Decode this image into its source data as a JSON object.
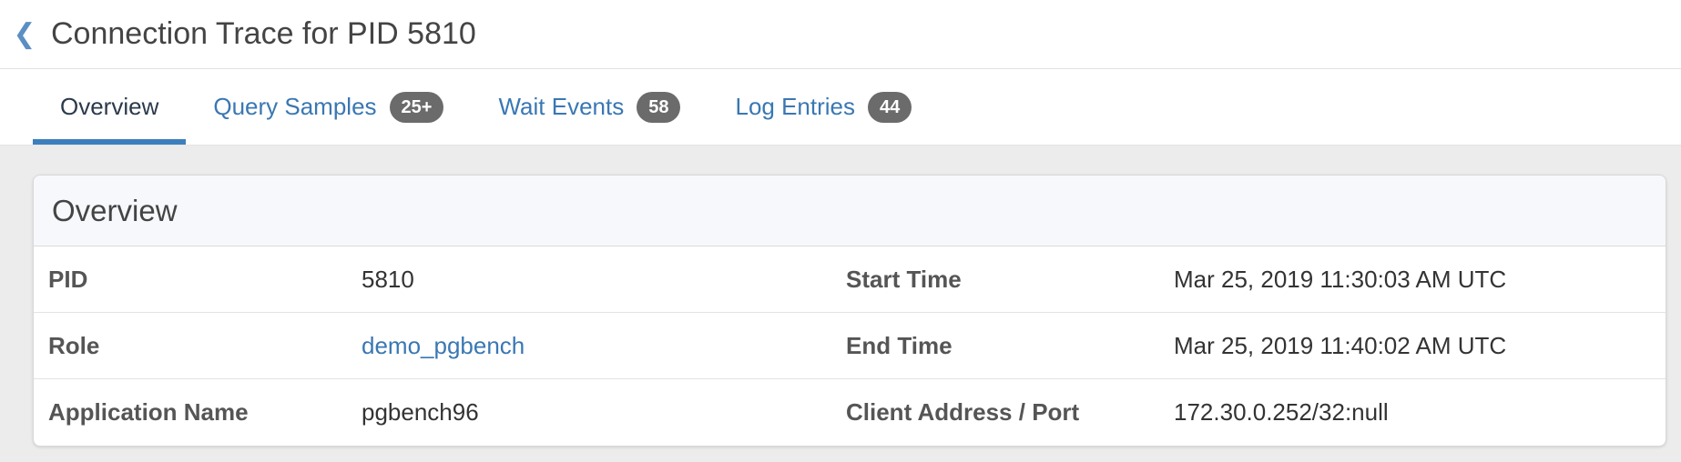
{
  "header": {
    "back_glyph": "❮",
    "title": "Connection Trace for PID 5810"
  },
  "tabs": [
    {
      "label": "Overview",
      "badge": ""
    },
    {
      "label": "Query Samples",
      "badge": "25+"
    },
    {
      "label": "Wait Events",
      "badge": "58"
    },
    {
      "label": "Log Entries",
      "badge": "44"
    }
  ],
  "overview": {
    "title": "Overview",
    "rows": [
      {
        "label1": "PID",
        "value1": "5810",
        "label2": "Start Time",
        "value2": "Mar 25, 2019 11:30:03 AM UTC"
      },
      {
        "label1": "Role",
        "value1": "demo_pgbench",
        "label2": "End Time",
        "value2": "Mar 25, 2019 11:40:02 AM UTC"
      },
      {
        "label1": "Application Name",
        "value1": "pgbench96",
        "label2": "Client Address / Port",
        "value2": "172.30.0.252/32:null"
      }
    ]
  },
  "colors": {
    "accent": "#3d7fbd",
    "link": "#3a77b3",
    "badge": "#6b6b6b"
  }
}
